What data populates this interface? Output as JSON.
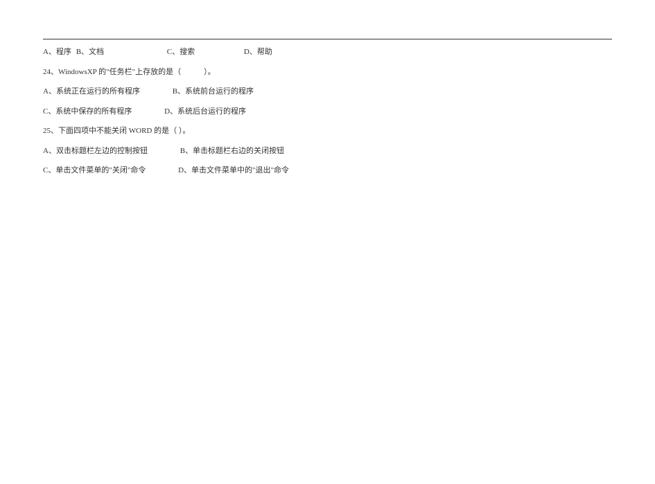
{
  "q23_options": {
    "a": "A、程序",
    "b": "B、文档",
    "c": "C、搜索",
    "d": "D、帮助"
  },
  "q24": {
    "stem": "24、WindowsXP 的\"任务栏\"上存放的是（　　　）。",
    "a": "A、系统正在运行的所有程序",
    "b": "B、系统前台运行的程序",
    "c": "C、系统中保存的所有程序",
    "d": "D、系统后台运行的程序"
  },
  "q25": {
    "stem": "25、下面四项中不能关闭 WORD 的是（ ）。",
    "a": "A、双击标题栏左边的控制按钮",
    "b": "B、单击标题栏右边的关闭按钮",
    "c": "C、单击文件菜单的\"关闭\"命令",
    "d": "D、单击文件菜单中的\"退出\"命令"
  }
}
